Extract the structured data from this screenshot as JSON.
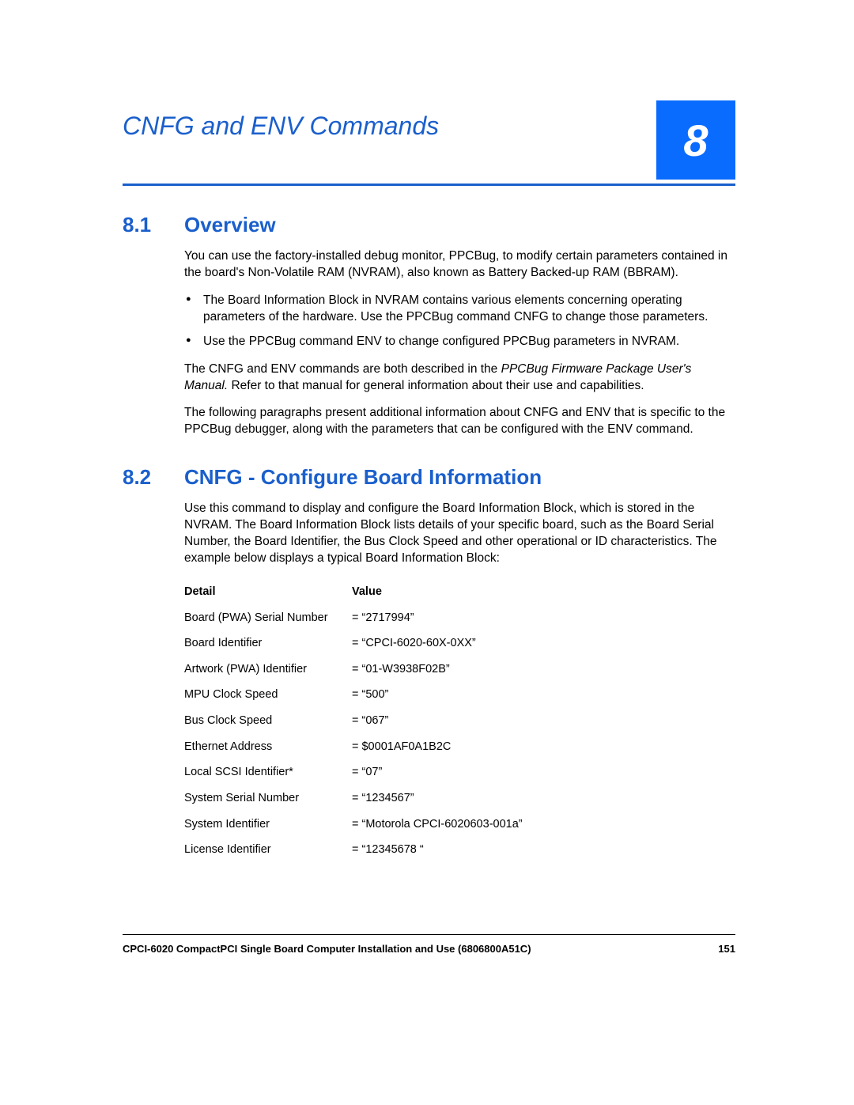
{
  "chapter": {
    "title": "CNFG and ENV Commands",
    "number": "8"
  },
  "sections": {
    "s1": {
      "num": "8.1",
      "title": "Overview",
      "p1": "You can use the factory-installed debug monitor, PPCBug, to modify certain parameters contained in the board's Non-Volatile RAM (NVRAM), also known as Battery Backed-up RAM (BBRAM).",
      "b1": "The Board Information Block in NVRAM contains various elements concerning operating parameters of the hardware. Use the PPCBug command CNFG to change those parameters.",
      "b2": "Use the PPCBug command ENV to change configured PPCBug parameters in NVRAM.",
      "p2a": "The CNFG and ENV commands are both described in the ",
      "p2i": "PPCBug Firmware Package User's Manual.",
      "p2b": " Refer to that manual for general information about their use and capabilities.",
      "p3": "The following paragraphs present additional information about CNFG and ENV that is specific to the PPCBug debugger, along with the parameters that can be configured with the ENV command."
    },
    "s2": {
      "num": "8.2",
      "title": "CNFG - Configure Board Information",
      "p1": "Use this command to display and configure the Board Information Block, which is stored in the NVRAM. The Board Information Block lists details of your specific board, such as the Board Serial Number, the Board Identifier, the Bus Clock Speed and other operational or ID characteristics. The example below displays a typical Board Information Block:",
      "table": {
        "head_detail": "Detail",
        "head_value": "Value",
        "rows": [
          {
            "detail": "Board (PWA) Serial Number",
            "value": "= “2717994”"
          },
          {
            "detail": "Board Identifier",
            "value": "= “CPCI-6020-60X-0XX”"
          },
          {
            "detail": "Artwork (PWA) Identifier",
            "value": "= “01-W3938F02B”"
          },
          {
            "detail": "MPU Clock Speed",
            "value": "= “500”"
          },
          {
            "detail": "Bus Clock Speed",
            "value": "= “067”"
          },
          {
            "detail": "Ethernet Address",
            "value": "= $0001AF0A1B2C"
          },
          {
            "detail": "Local SCSI Identifier*",
            "value": "= “07”"
          },
          {
            "detail": "System Serial Number",
            "value": "= “1234567”"
          },
          {
            "detail": "System Identifier",
            "value": "= “Motorola CPCI-6020603-001a”"
          },
          {
            "detail": "License Identifier",
            "value": "= “12345678 “"
          }
        ]
      }
    }
  },
  "footer": {
    "doc": "CPCI-6020 CompactPCI Single Board Computer Installation and Use (6806800A51C)",
    "page": "151"
  }
}
